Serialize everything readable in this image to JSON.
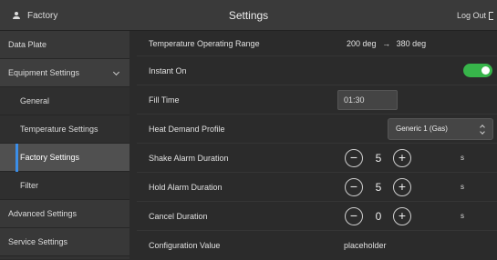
{
  "header": {
    "user_label": "Factory",
    "title": "Settings",
    "logout_label": "Log Out"
  },
  "sidebar": {
    "items": [
      {
        "label": "Data Plate"
      },
      {
        "label": "Equipment Settings"
      },
      {
        "label": "General"
      },
      {
        "label": "Temperature Settings"
      },
      {
        "label": "Factory Settings"
      },
      {
        "label": "Filter"
      },
      {
        "label": "Advanced Settings"
      },
      {
        "label": "Service Settings"
      }
    ],
    "active": "Factory Settings"
  },
  "settings": {
    "temp_range": {
      "label": "Temperature Operating Range",
      "min": "200",
      "min_unit": "deg",
      "arrow": "→",
      "max": "380",
      "max_unit": "deg"
    },
    "instant_on": {
      "label": "Instant On",
      "state": "on"
    },
    "fill_time": {
      "label": "Fill Time",
      "value": "01:30"
    },
    "heat_demand": {
      "label": "Heat Demand Profile",
      "selected": "Generic 1 (Gas)"
    },
    "shake_alarm": {
      "label": "Shake Alarm Duration",
      "value": "5",
      "unit": "s"
    },
    "hold_alarm": {
      "label": "Hold Alarm Duration",
      "value": "5",
      "unit": "s"
    },
    "cancel": {
      "label": "Cancel Duration",
      "value": "0",
      "unit": "s"
    },
    "config": {
      "label": "Configuration Value",
      "value": "placeholder"
    }
  },
  "colors": {
    "accent_blue": "#3b8ee8",
    "toggle_on": "#37b54a"
  },
  "icons": {
    "user": "user-icon",
    "logout": "logout-icon",
    "chevron": "chevron-down-icon",
    "select": "select-updown-icon"
  }
}
